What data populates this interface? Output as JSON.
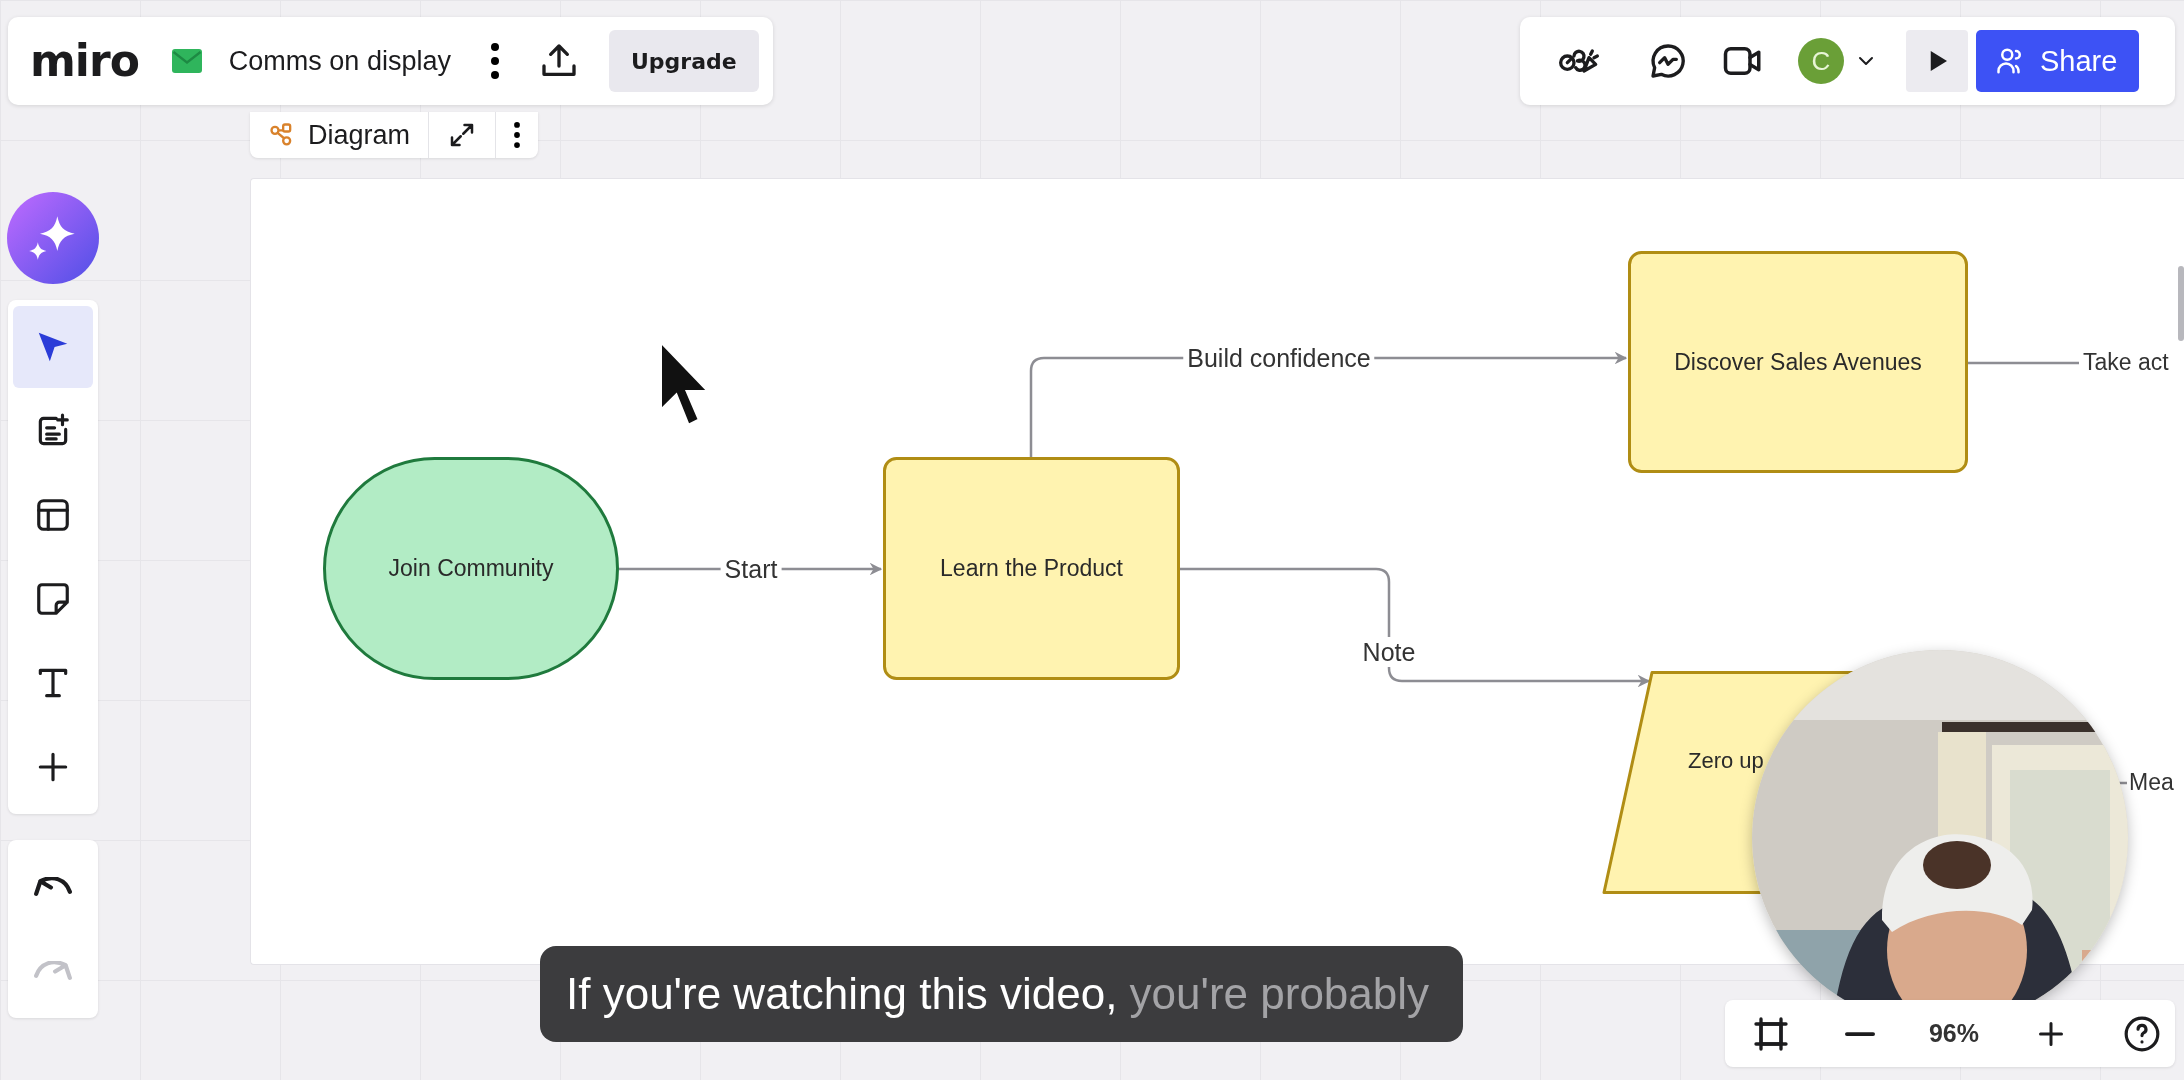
{
  "board": {
    "logo": "miro",
    "title": "Comms on display",
    "upgrade": "Upgrade"
  },
  "diagram_toolbar": {
    "label": "Diagram"
  },
  "top_right": {
    "avatar": "C",
    "share": "Share"
  },
  "tools": [
    {
      "kind": "select",
      "selected": true
    },
    {
      "kind": "doc",
      "selected": false
    },
    {
      "kind": "template",
      "selected": false
    },
    {
      "kind": "sticky",
      "selected": false
    },
    {
      "kind": "text",
      "selected": false
    },
    {
      "kind": "add",
      "selected": false
    }
  ],
  "history": [
    {
      "kind": "undo",
      "disabled": false
    },
    {
      "kind": "redo",
      "disabled": true
    }
  ],
  "diagram": {
    "nodes": [
      {
        "kind": "stadium",
        "label": "Join Community",
        "color": "#b2ecc5"
      },
      {
        "kind": "process",
        "label": "Learn the Product",
        "color": "#fff3b0"
      },
      {
        "kind": "process",
        "label": "Discover Sales Avenues",
        "color": "#fff3b0"
      },
      {
        "kind": "data",
        "label": "Zero up",
        "color": "#fff3b0"
      }
    ],
    "edges": [
      {
        "label": "Start"
      },
      {
        "label": "Build confidence"
      },
      {
        "label": "Note"
      },
      {
        "label": "Take act"
      },
      {
        "label": "Mea"
      }
    ]
  },
  "caption": {
    "text": "If you're watching this video,",
    "upcoming": "you're probably"
  },
  "zoom": {
    "value": "96%"
  }
}
